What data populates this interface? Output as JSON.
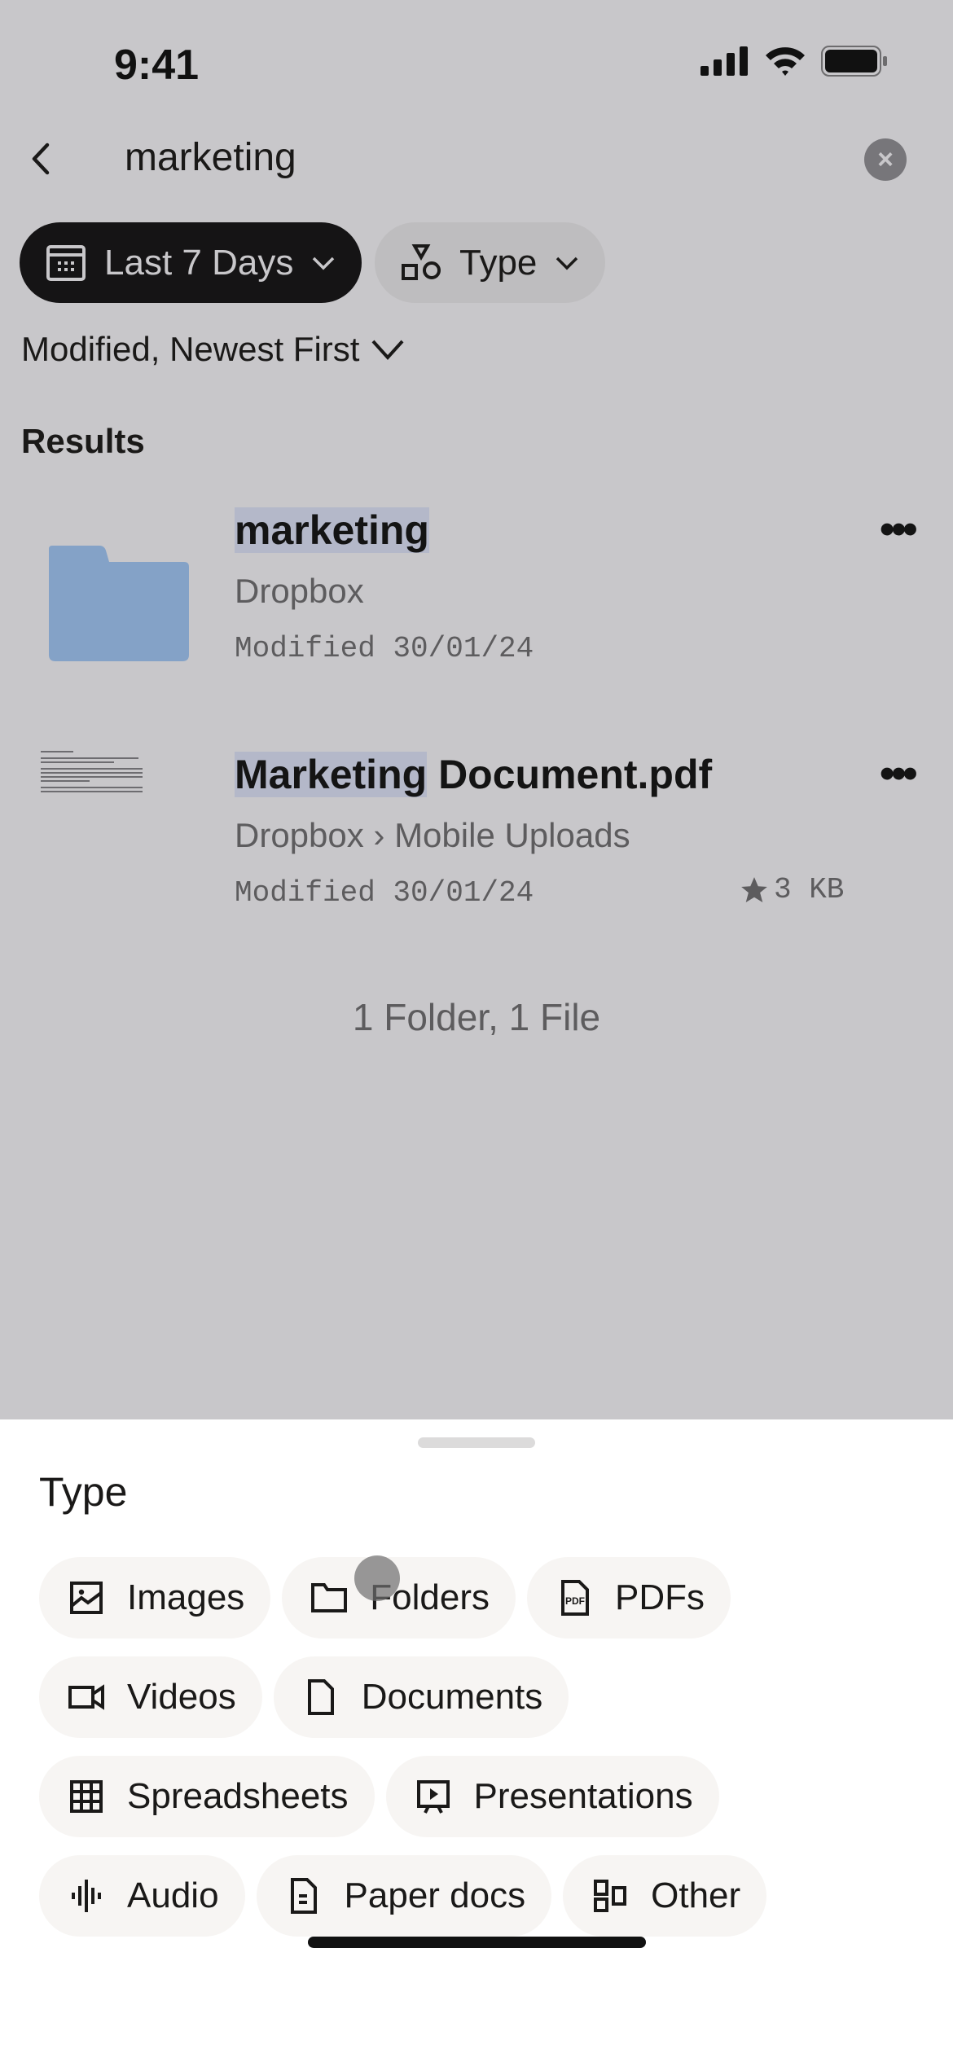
{
  "status_bar": {
    "time": "9:41"
  },
  "search": {
    "query": "marketing"
  },
  "filters": {
    "date_label": "Last 7 Days",
    "type_label": "Type"
  },
  "sort": {
    "label": "Modified, Newest First"
  },
  "results": {
    "heading": "Results",
    "items": [
      {
        "title_highlight": "marketing",
        "title_rest": "",
        "location": "Dropbox",
        "modified": "Modified 30/01/24",
        "size": "",
        "starred": false,
        "kind": "folder"
      },
      {
        "title_highlight": "Marketing",
        "title_rest": " Document.pdf",
        "location": "Dropbox › Mobile Uploads",
        "modified": "Modified 30/01/24",
        "size": "3 KB",
        "starred": true,
        "kind": "pdf"
      }
    ],
    "summary": "1 Folder, 1 File"
  },
  "type_sheet": {
    "title": "Type",
    "options": [
      {
        "label": "Images",
        "icon": "image-icon"
      },
      {
        "label": "Folders",
        "icon": "folder-icon"
      },
      {
        "label": "PDFs",
        "icon": "pdf-icon"
      },
      {
        "label": "Videos",
        "icon": "video-icon"
      },
      {
        "label": "Documents",
        "icon": "document-icon"
      },
      {
        "label": "Spreadsheets",
        "icon": "spreadsheet-icon"
      },
      {
        "label": "Presentations",
        "icon": "presentation-icon"
      },
      {
        "label": "Audio",
        "icon": "audio-icon"
      },
      {
        "label": "Paper docs",
        "icon": "paper-doc-icon"
      },
      {
        "label": "Other",
        "icon": "other-icon"
      }
    ]
  },
  "colors": {
    "overlay": "#c8c7ca",
    "folder": "#84a2c7",
    "highlight": "#b4b8c9",
    "chip_bg": "#f7f5f3"
  }
}
